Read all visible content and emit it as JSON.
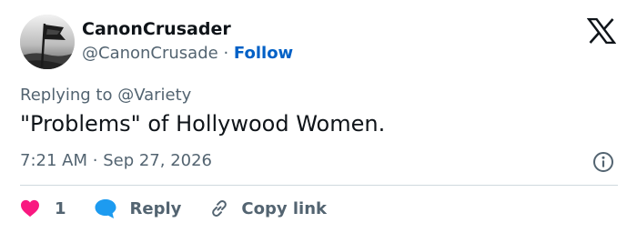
{
  "author": {
    "display_name": "CanonCrusader",
    "handle": "@CanonCrusade",
    "separator": "·",
    "follow_label": "Follow"
  },
  "platform": {
    "logo_icon": "x-logo-icon"
  },
  "reply_context": {
    "prefix": "Replying to ",
    "mention": "@Variety"
  },
  "tweet": {
    "text": "\"Problems\" of Hollywood Women.",
    "time": "7:21 AM",
    "separator": "·",
    "date": "Sep 27, 2026"
  },
  "actions": {
    "like_count": "1",
    "reply_label": "Reply",
    "copy_label": "Copy link"
  },
  "colors": {
    "accent": "#0060c6",
    "like": "#f91880",
    "reply_bubble": "#1d9bf0",
    "muted_text": "#536471",
    "divider": "#cfd9de"
  }
}
